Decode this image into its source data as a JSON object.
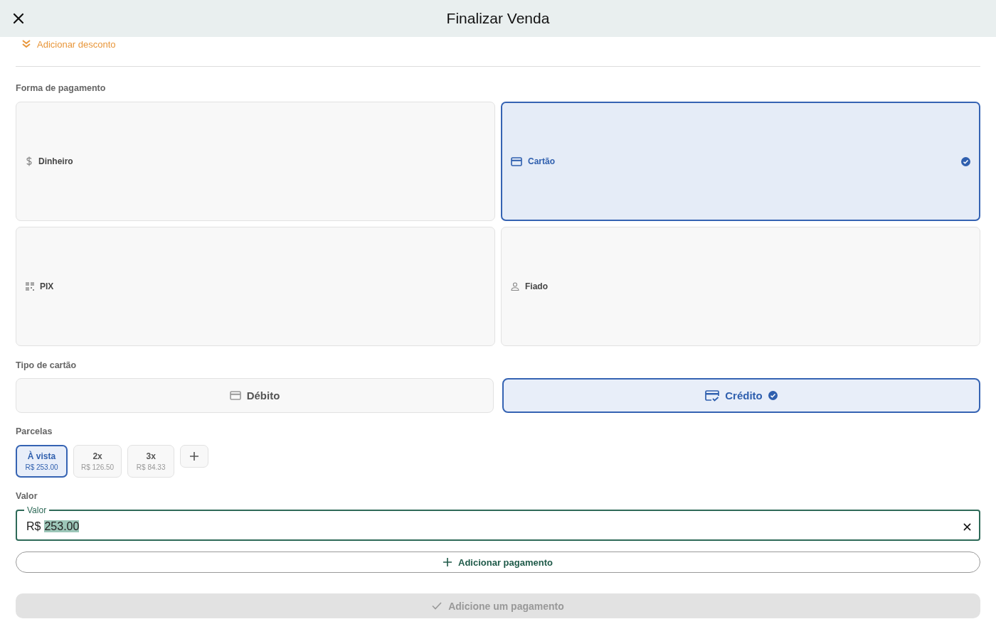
{
  "header": {
    "title": "Finalizar Venda"
  },
  "discount_link": "Adicionar desconto",
  "payment_section": {
    "label": "Forma de pagamento",
    "methods": [
      {
        "label": "Dinheiro",
        "kind": "dollar",
        "selected": false
      },
      {
        "label": "Cartão",
        "kind": "card",
        "selected": true
      },
      {
        "label": "PIX",
        "kind": "qr",
        "selected": false
      },
      {
        "label": "Fiado",
        "kind": "person",
        "selected": false
      }
    ]
  },
  "card_type": {
    "label": "Tipo de cartão",
    "options": [
      {
        "label": "Débito",
        "kind": "card",
        "selected": false
      },
      {
        "label": "Crédito",
        "kind": "card-check",
        "selected": true
      }
    ]
  },
  "installments": {
    "label": "Parcelas",
    "options": [
      {
        "label": "À vista",
        "amount": "R$ 253.00",
        "selected": true
      },
      {
        "label": "2x",
        "amount": "R$ 126.50",
        "selected": false
      },
      {
        "label": "3x",
        "amount": "R$ 84.33",
        "selected": false
      }
    ]
  },
  "amount": {
    "section_label": "Valor",
    "field_label": "Valor",
    "prefix": "R$",
    "value": "253.00",
    "value_selected": true
  },
  "add_payment_button": "Adicionar pagamento",
  "confirm_button": {
    "label": "Adicione um pagamento",
    "disabled": true
  }
}
